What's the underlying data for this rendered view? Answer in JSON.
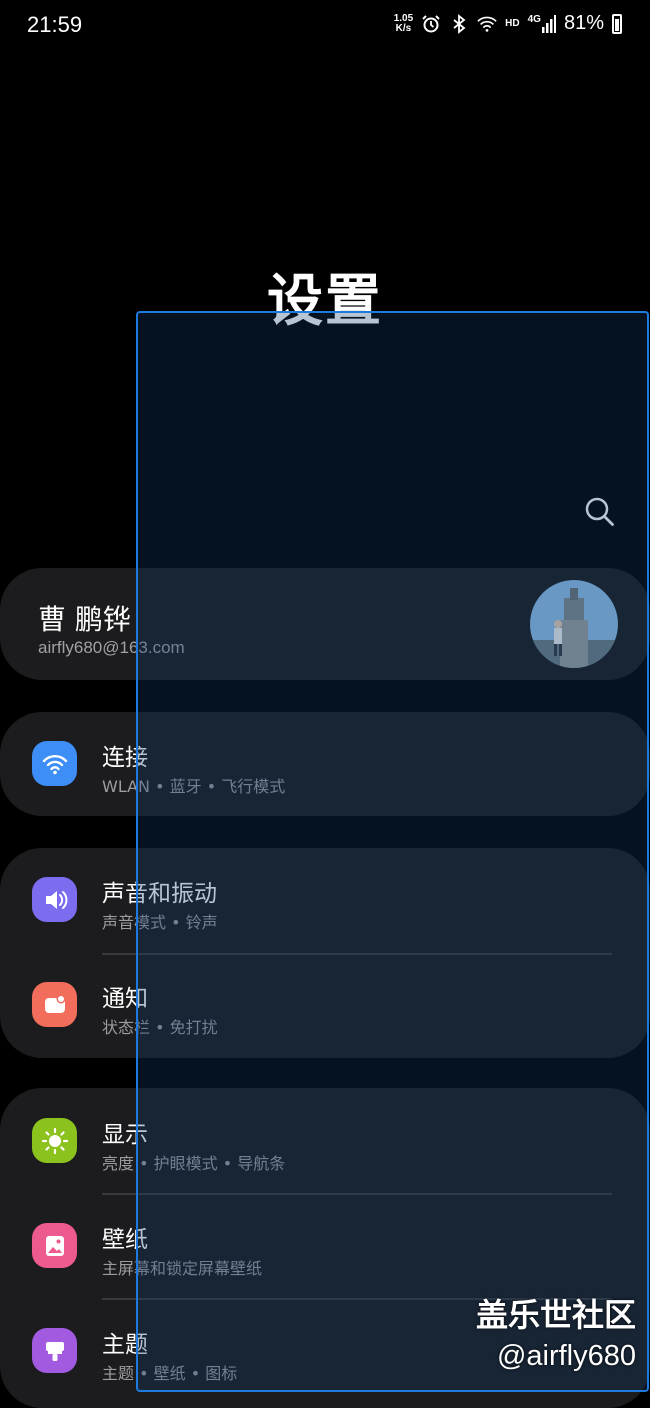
{
  "status": {
    "time": "21:59",
    "net_speed_value": "1.05",
    "net_speed_unit": "K/s",
    "hd": "HD",
    "network": "4G",
    "battery": "81%"
  },
  "page_title": "设置",
  "account": {
    "name": "曹 鹏铧",
    "email": "airfly680@163.com"
  },
  "menu": {
    "connections": {
      "title": "连接",
      "subtitle": "WLAN • 蓝牙 • 飞行模式",
      "icon": "wifi-icon",
      "color": "#3d8ef6"
    },
    "sound": {
      "title": "声音和振动",
      "subtitle": "声音模式 • 铃声",
      "icon": "volume-icon",
      "color": "#7c6df0"
    },
    "notifications": {
      "title": "通知",
      "subtitle": "状态栏 • 免打扰",
      "icon": "notification-icon",
      "color": "#f26d5b"
    },
    "display": {
      "title": "显示",
      "subtitle": "亮度 • 护眼模式 • 导航条",
      "icon": "brightness-icon",
      "color": "#8cc21d"
    },
    "wallpaper": {
      "title": "壁纸",
      "subtitle": "主屏幕和锁定屏幕壁纸",
      "icon": "wallpaper-icon",
      "color": "#ec5a8f"
    },
    "themes": {
      "title": "主题",
      "subtitle": "主题 • 壁纸 • 图标",
      "icon": "theme-brush-icon",
      "color": "#a25be0"
    }
  },
  "watermark": {
    "title": "盖乐世社区",
    "handle": "@airfly680"
  }
}
